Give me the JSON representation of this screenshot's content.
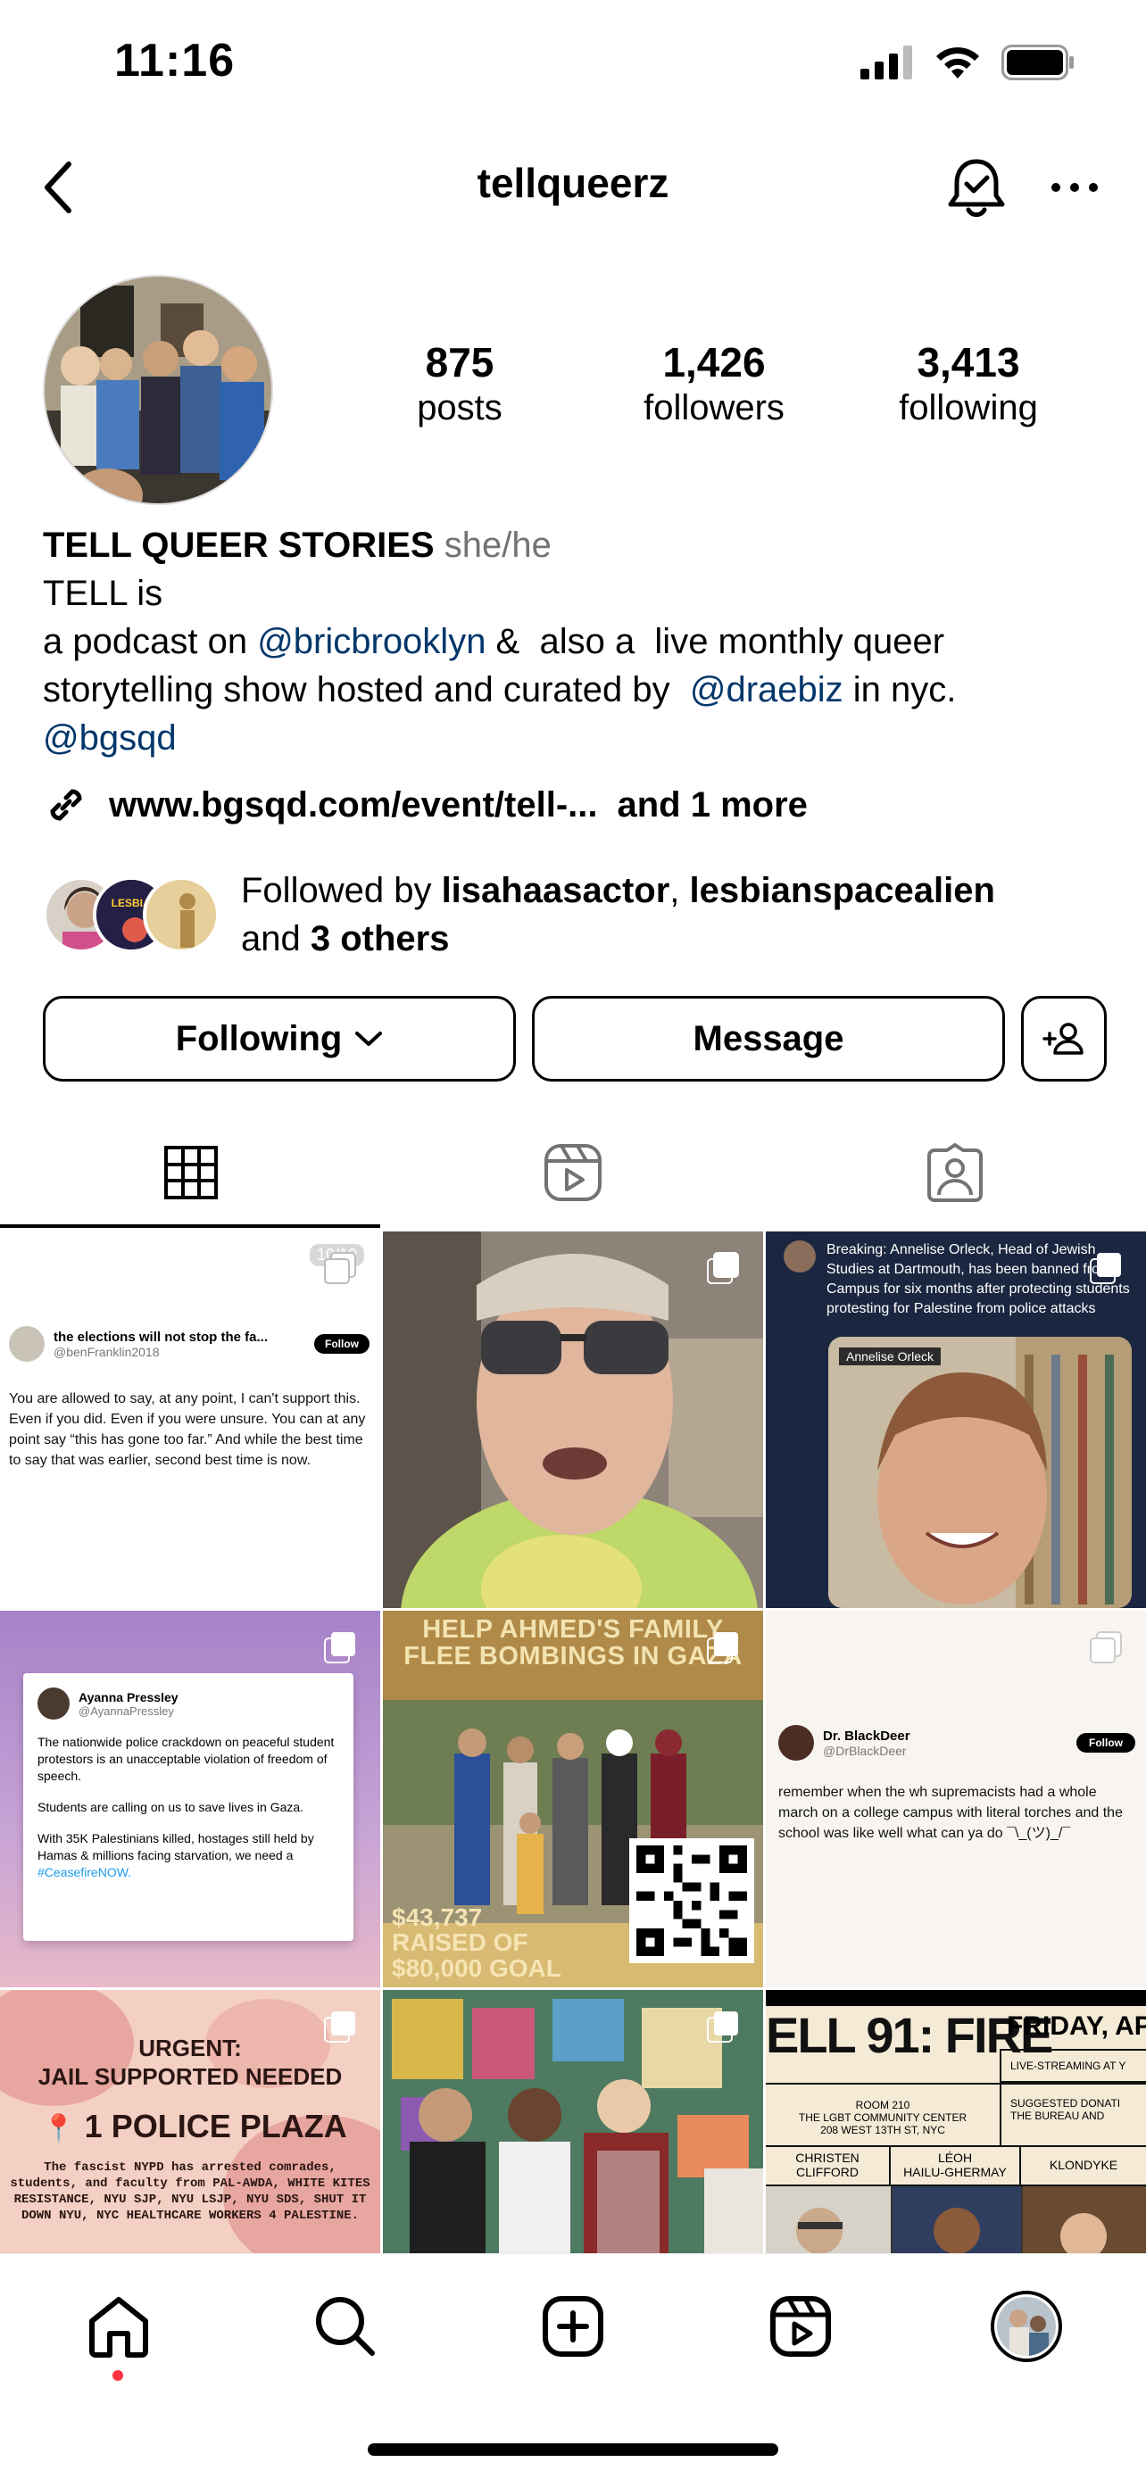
{
  "status": {
    "time": "11:16"
  },
  "header": {
    "username": "tellqueerz"
  },
  "profile": {
    "stats": [
      {
        "num": "875",
        "label": "posts"
      },
      {
        "num": "1,426",
        "label": "followers"
      },
      {
        "num": "3,413",
        "label": "following"
      }
    ],
    "name": "TELL QUEER STORIES",
    "pronouns": "she/he",
    "bio_line1": "TELL is",
    "bio_line2_pre": "a podcast on ",
    "mention1": "@bricbrooklyn",
    "bio_line2_post": " &  also a  live monthly queer",
    "bio_line3_pre": "storytelling show hosted and curated by  ",
    "mention2": "@draebiz",
    "bio_line3_post": " in nyc.",
    "mention3": "@bgsqd",
    "link": "www.bgsqd.com/event/tell-...",
    "link_more": "and 1 more",
    "followed_prefix": "Followed by ",
    "followed_user1": "lisahaasactor",
    "followed_sep": ", ",
    "followed_user2": "lesbianspacealien",
    "followed_and": "and ",
    "followed_others": "3 others"
  },
  "actions": {
    "following": "Following",
    "message": "Message"
  },
  "posts": {
    "p1": {
      "counter": "10/10",
      "handle_line": "the elections will not stop the fa...",
      "sub": "@benFranklin2018",
      "follow": "Follow",
      "text": "You are allowed to say, at any point, I can't support this. Even if you did. Even if you were unsure. You can at any point say “this has gone too far.” And while the best time to say that was earlier, second best time is now."
    },
    "p3": {
      "text": "Breaking: Annelise Orleck, Head of Jewish Studies at Dartmouth, has been banned from Campus for six months after protecting students protesting for Palestine from police attacks",
      "caption": "Annelise Orleck"
    },
    "p4": {
      "name": "Ayanna Pressley",
      "handle": "@AyannaPressley",
      "para1": "The nationwide police crackdown on peaceful student protestors is an unacceptable violation of freedom of speech.",
      "para2": "Students are calling on us to save lives in Gaza.",
      "para3": "With 35K Palestinians killed, hostages still held by Hamas & millions facing starvation, we need a ",
      "hashtag": "#CeasefireNOW."
    },
    "p5": {
      "headline": "HELP AHMED'S FAMILY FLEE BOMBINGS IN GAZA",
      "raised": "$43,737",
      "raised_label": "RAISED OF",
      "goal": "$80,000 GOAL"
    },
    "p6": {
      "name": "Dr. BlackDeer",
      "handle": "@DrBlackDeer",
      "follow": "Follow",
      "text": "remember when the wh    supremacists had a whole march on a college campus with literal torches and the school was like well what can ya do ¯\\_(ツ)_/¯"
    },
    "p7": {
      "line1": "URGENT:",
      "line2": "JAIL SUPPORTED NEEDED",
      "line3": "1 POLICE PLAZA",
      "body": "The fascist NYPD has arrested comrades, students, and faculty from PAL-AWDA, WHITE KITES RESISTANCE, NYU SJP, NYU LSJP, NYU SDS, SHUT IT DOWN NYU, NYC HEALTHCARE WORKERS 4 PALESTINE."
    },
    "p9": {
      "title": "ELL 91: FIRE",
      "date": "FRIDAY, AP",
      "live": "LIVE-STREAMING AT Y",
      "room": "ROOM 210",
      "venue": "THE LGBT COMMUNITY CENTER",
      "addr": "208 WEST 13TH ST, NYC",
      "donation": "SUGGESTED DONATI",
      "bureau": "THE BUREAU AND",
      "n1a": "CHRISTEN",
      "n1b": "CLIFFORD",
      "n2a": "LÉOH",
      "n2b": "HAILU-GHERMAY",
      "n3": "KLONDYKE"
    }
  },
  "colors": {
    "mention": "#00376b",
    "secondary": "#737373",
    "notification_dot": "#ff3040"
  }
}
